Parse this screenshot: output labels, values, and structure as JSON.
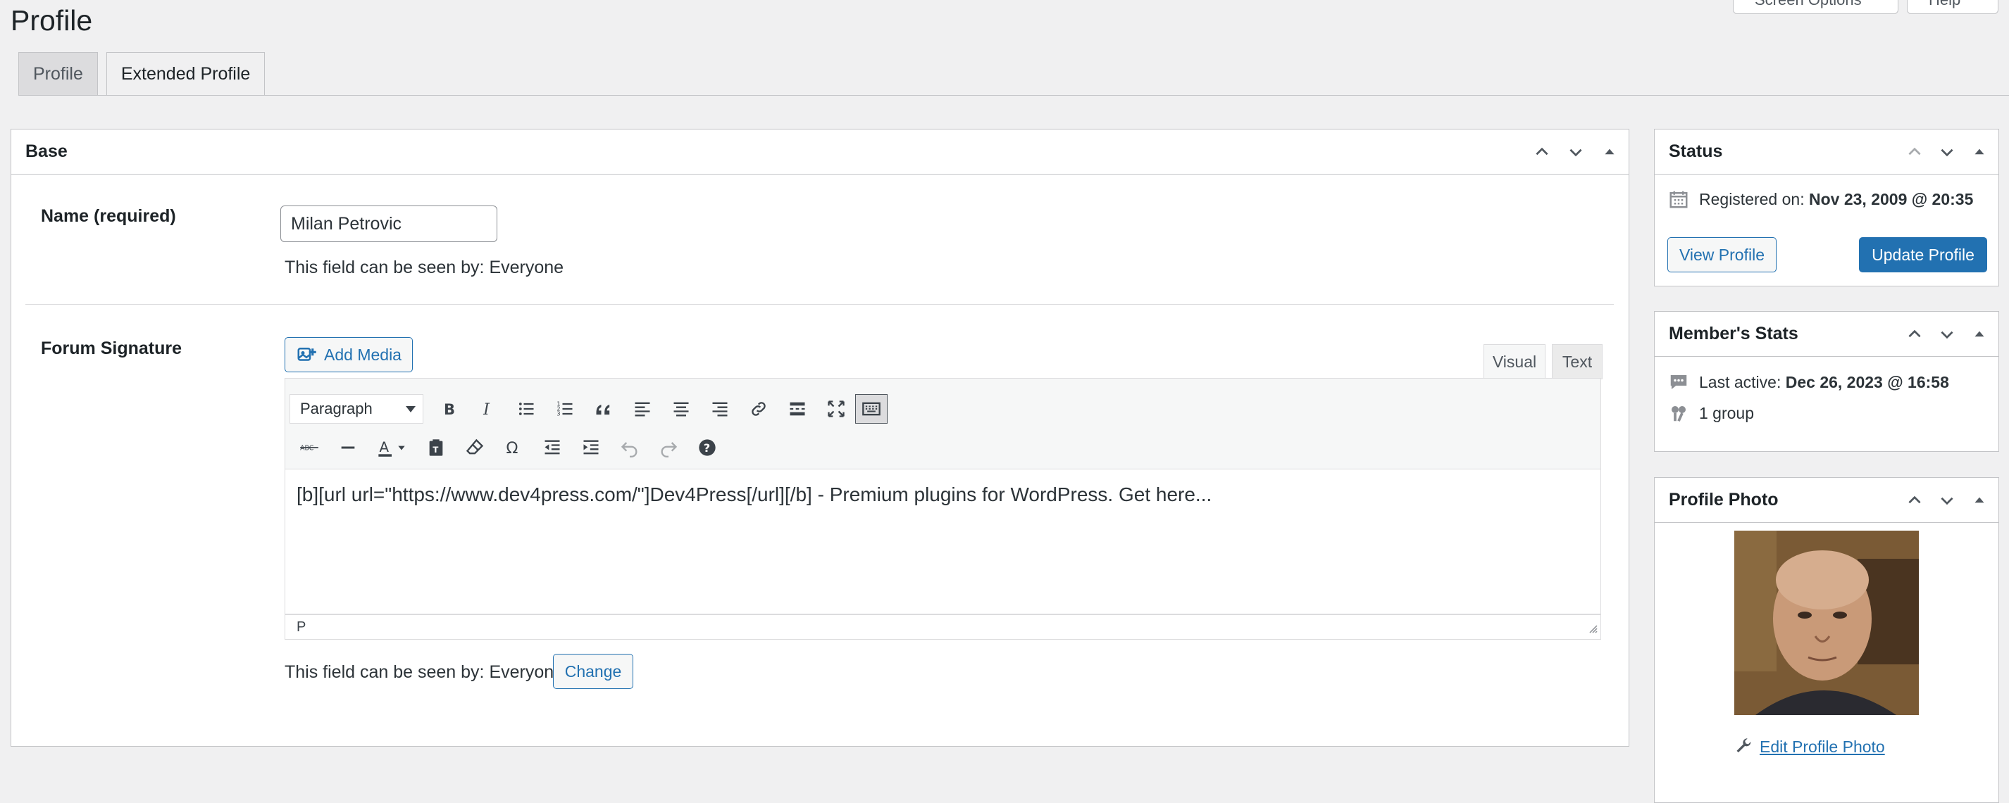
{
  "header": {
    "title": "Profile",
    "screen_options_label": "Screen Options",
    "help_label": "Help"
  },
  "tabs": [
    {
      "label": "Profile"
    },
    {
      "label": "Extended Profile"
    }
  ],
  "base_box": {
    "title": "Base",
    "name_label": "Name (required)",
    "name_value": "Milan Petrovic",
    "name_visibility": "This field can be seen by: Everyone",
    "signature_label": "Forum Signature",
    "add_media_label": "Add Media",
    "visual_tab": "Visual",
    "text_tab": "Text",
    "format_select": "Paragraph",
    "editor_content": "[b][url url=\"https://www.dev4press.com/\"]Dev4Press[/url][/b] - Premium plugins for WordPress. Get here...",
    "status_path": "P",
    "signature_visibility": "This field can be seen by: Everyone",
    "change_label": "Change"
  },
  "status_box": {
    "title": "Status",
    "registered_label": "Registered on:",
    "registered_value": "Nov 23, 2009 @ 20:35",
    "view_profile_label": "View Profile",
    "update_profile_label": "Update Profile"
  },
  "stats_box": {
    "title": "Member's Stats",
    "last_active_label": "Last active:",
    "last_active_value": "Dec 26, 2023 @ 16:58",
    "groups": "1 group"
  },
  "photo_box": {
    "title": "Profile Photo",
    "edit_label": "Edit Profile Photo"
  },
  "colors": {
    "accent": "#2271b1",
    "background": "#f0f0f1"
  }
}
